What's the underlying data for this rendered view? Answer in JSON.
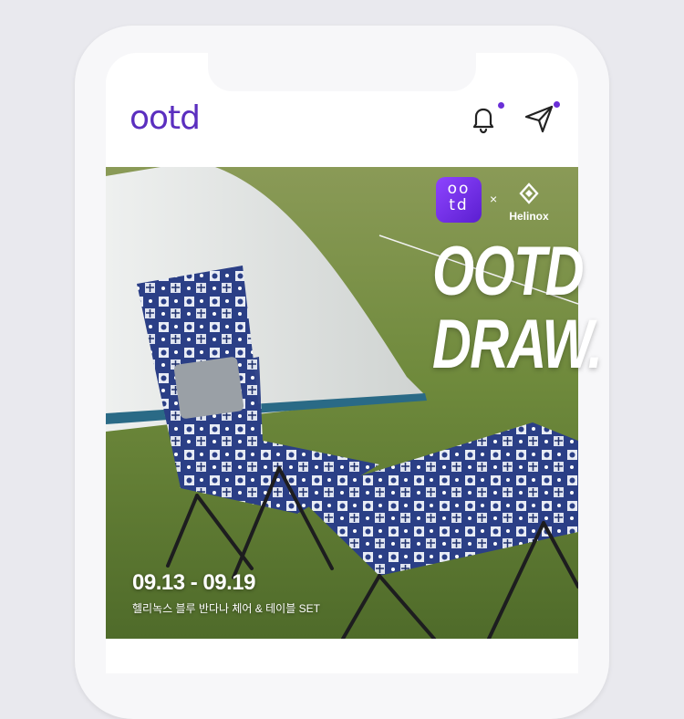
{
  "app": {
    "logo_text": "ootd",
    "notification_indicator": true,
    "message_indicator": true
  },
  "icons": {
    "bell": "bell-icon",
    "send": "paper-plane-icon"
  },
  "banner": {
    "partner_badge_text_top": "oo",
    "partner_badge_text_bottom": "td",
    "separator": "×",
    "partner_name": "Helinox",
    "headline_line1": "OOTD",
    "headline_line2": "DRAW.",
    "dates": "09.13 - 09.19",
    "subtitle": "헬리녹스 블루 반다나 체어 & 테이블 SET"
  },
  "colors": {
    "brand": "#5b2fbf",
    "badge_gradient_start": "#8e44ff",
    "badge_gradient_end": "#5b1fd0",
    "indicator": "#6a2fd7"
  }
}
